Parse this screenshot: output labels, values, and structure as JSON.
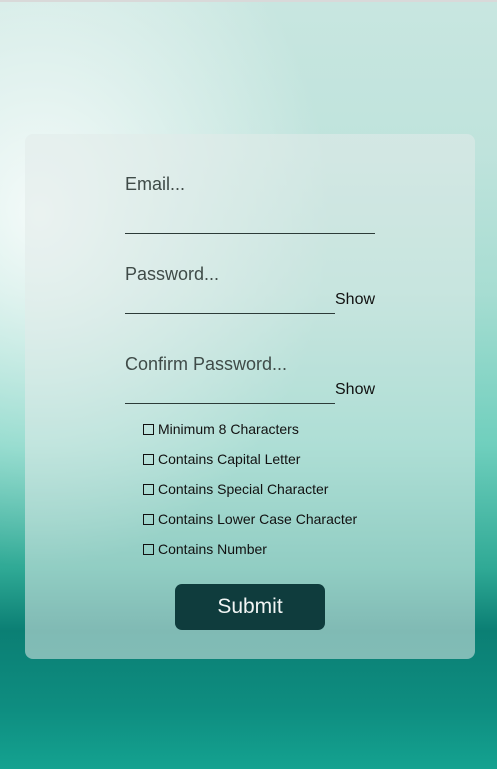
{
  "form": {
    "email": {
      "placeholder": "Email..."
    },
    "password": {
      "placeholder": "Password...",
      "toggle_label": "Show"
    },
    "confirm_password": {
      "placeholder": "Confirm Password...",
      "toggle_label": "Show"
    },
    "requirements": [
      {
        "label": "Minimum 8 Characters",
        "checked": false
      },
      {
        "label": "Contains Capital Letter",
        "checked": false
      },
      {
        "label": "Contains Special Character",
        "checked": false
      },
      {
        "label": "Contains Lower Case Character",
        "checked": false
      },
      {
        "label": "Contains Number",
        "checked": false
      }
    ],
    "submit_label": "Submit"
  },
  "colors": {
    "submit_bg": "#0f3c3d",
    "teal_band": "#0b7f74"
  }
}
